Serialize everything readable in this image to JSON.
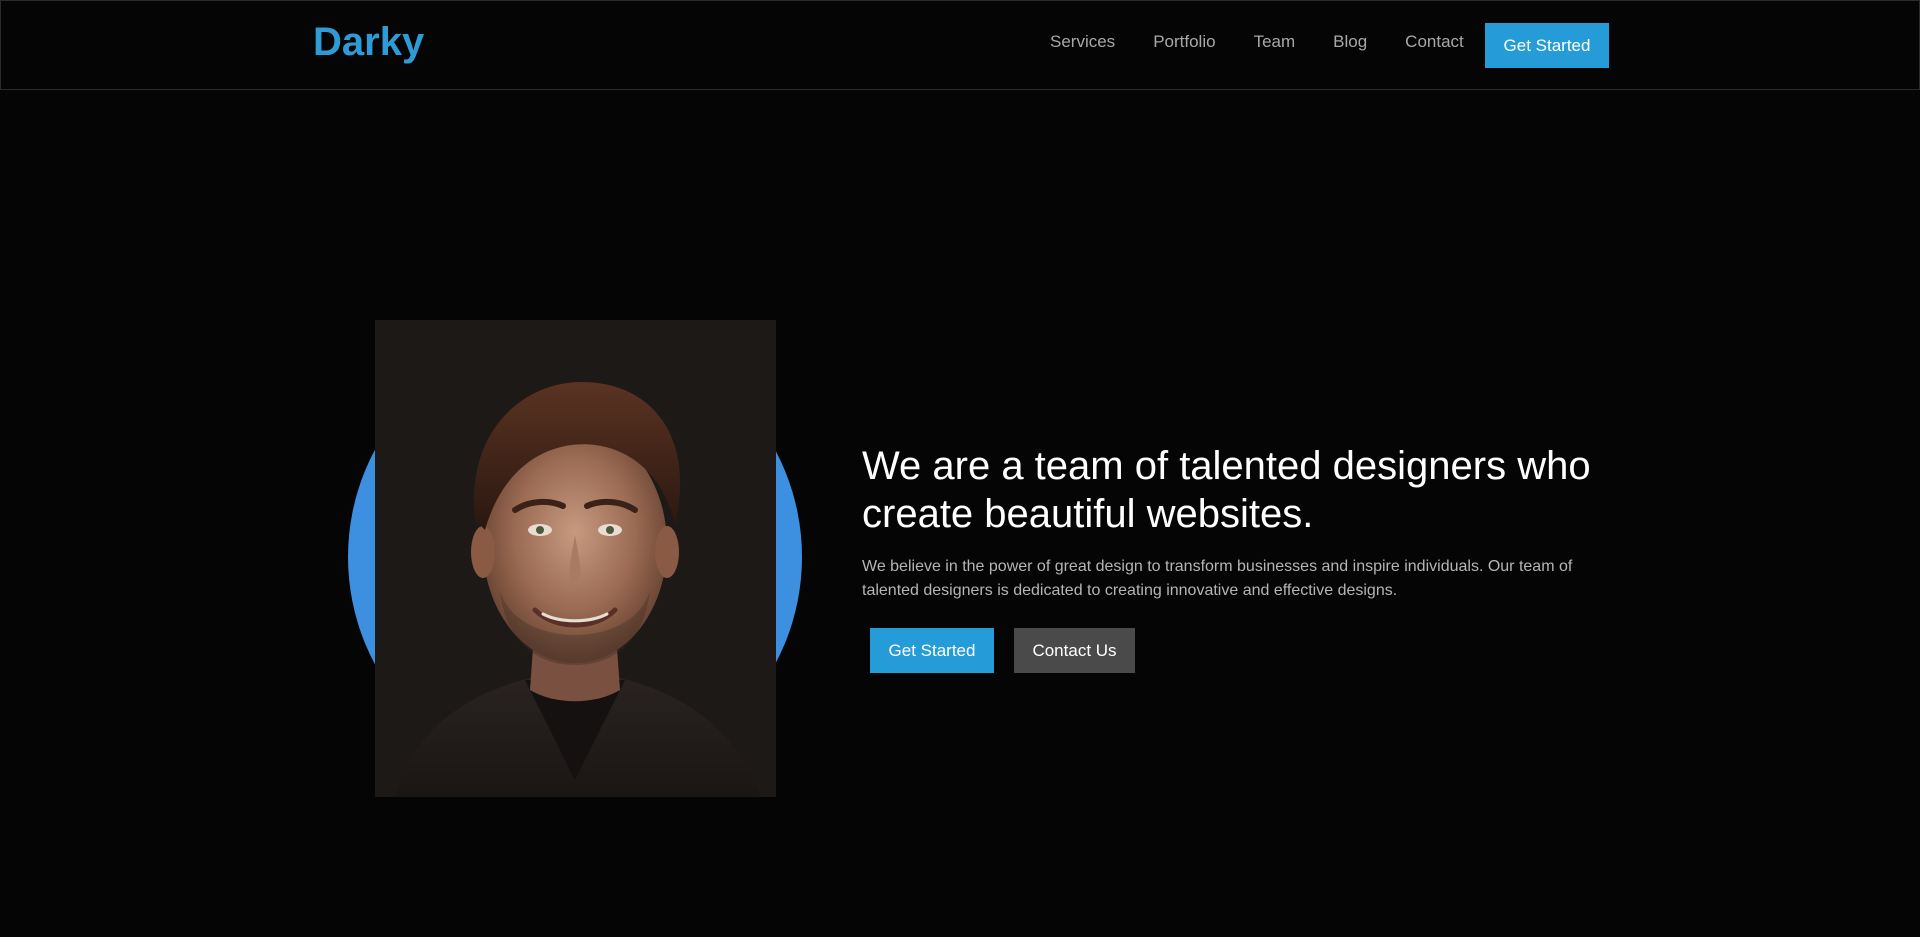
{
  "header": {
    "logo": "Darky",
    "nav": [
      "Services",
      "Portfolio",
      "Team",
      "Blog",
      "Contact"
    ],
    "cta_label": "Get Started"
  },
  "hero": {
    "title": "We are a team of talented designers who create beautiful websites.",
    "description": "We believe in the power of great design to transform businesses and inspire individuals. Our team of talented designers is dedicated to creating innovative and effective designs.",
    "primary_button": "Get Started",
    "secondary_button": "Contact Us",
    "portrait_alt": "smiling man portrait"
  },
  "colors": {
    "accent": "#259bd7",
    "circle": "#3d8fe0",
    "background": "#050505",
    "secondary_button": "#4a4a4a"
  }
}
